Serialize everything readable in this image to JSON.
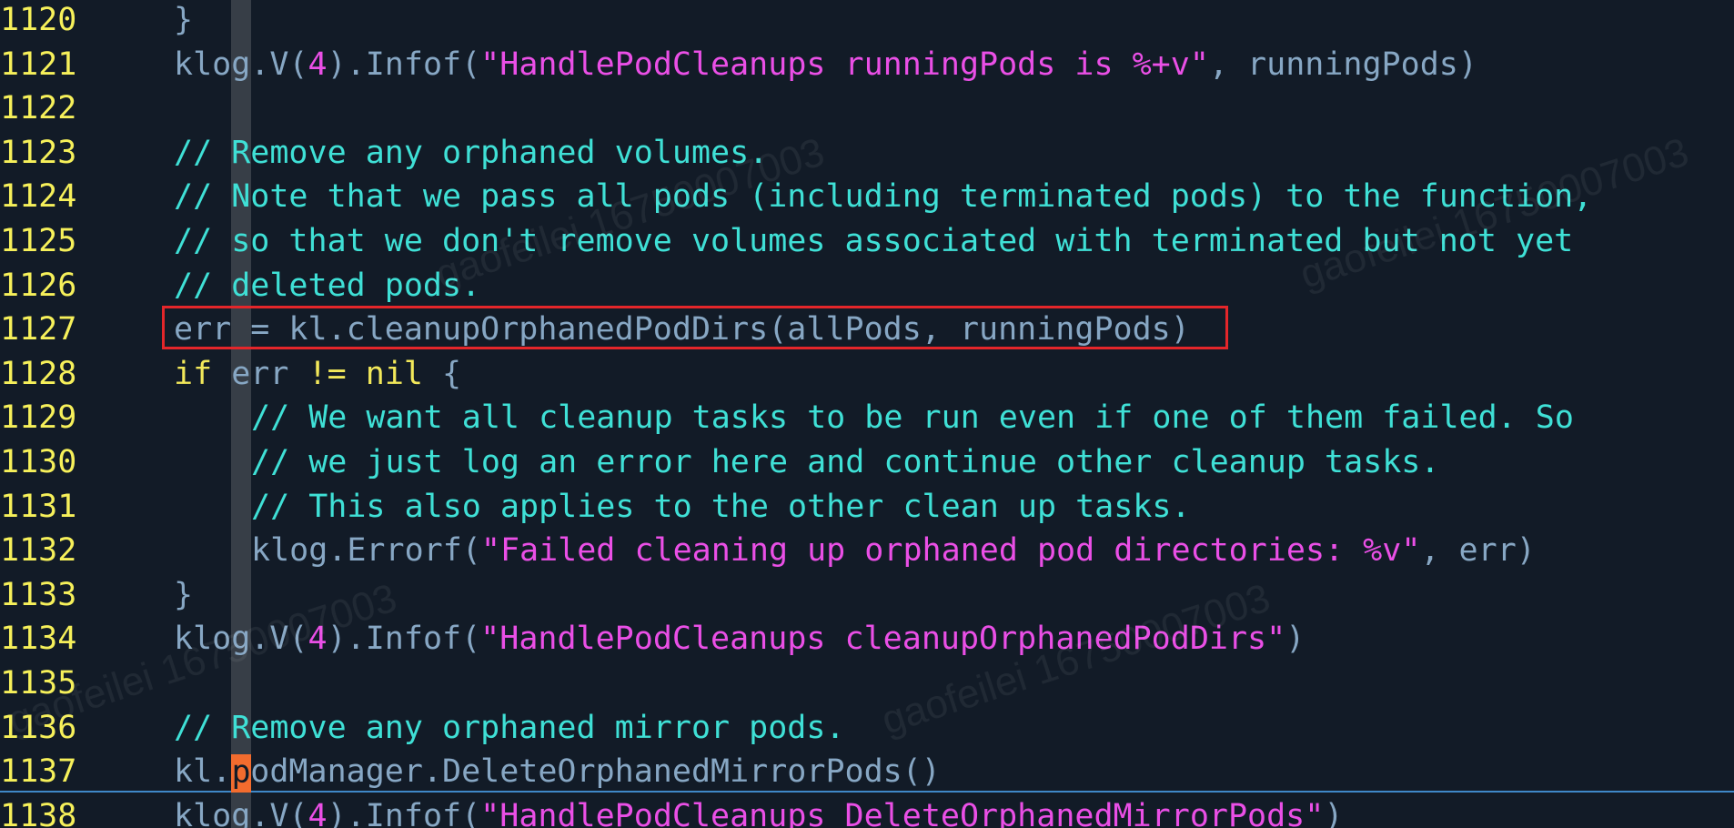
{
  "watermark": "gaofeilei 16750007003",
  "cursor": {
    "char": "p"
  },
  "lines": [
    {
      "num": "1120",
      "parts": [
        [
          "plain",
          "}"
        ]
      ]
    },
    {
      "num": "1121",
      "parts": [
        [
          "plain",
          "klog.V("
        ],
        [
          "num",
          "4"
        ],
        [
          "plain",
          ").Infof("
        ],
        [
          "str",
          "\"HandlePodCleanups runningPods is %+v\""
        ],
        [
          "plain",
          ", runningPods)"
        ]
      ]
    },
    {
      "num": "1122",
      "parts": []
    },
    {
      "num": "1123",
      "parts": [
        [
          "cmt",
          "// Remove any orphaned volumes."
        ]
      ]
    },
    {
      "num": "1124",
      "parts": [
        [
          "cmt",
          "// Note that we pass all pods (including terminated pods) to the function,"
        ]
      ]
    },
    {
      "num": "1125",
      "parts": [
        [
          "cmt",
          "// so that we don't remove volumes associated with terminated but not yet"
        ]
      ]
    },
    {
      "num": "1126",
      "parts": [
        [
          "cmt",
          "// deleted pods."
        ]
      ]
    },
    {
      "num": "1127",
      "parts": [
        [
          "plain",
          "err = kl.cleanupOrphanedPodDirs(allPods, runningPods)"
        ]
      ]
    },
    {
      "num": "1128",
      "parts": [
        [
          "kw",
          "if"
        ],
        [
          "plain",
          " err "
        ],
        [
          "kw",
          "!="
        ],
        [
          "plain",
          " "
        ],
        [
          "kw",
          "nil"
        ],
        [
          "plain",
          " {"
        ]
      ]
    },
    {
      "num": "1129",
      "indent": 2,
      "parts": [
        [
          "cmt",
          "// We want all cleanup tasks to be run even if one of them failed. So"
        ]
      ]
    },
    {
      "num": "1130",
      "indent": 2,
      "parts": [
        [
          "cmt",
          "// we just log an error here and continue other cleanup tasks."
        ]
      ]
    },
    {
      "num": "1131",
      "indent": 2,
      "parts": [
        [
          "cmt",
          "// This also applies to the other clean up tasks."
        ]
      ]
    },
    {
      "num": "1132",
      "indent": 2,
      "parts": [
        [
          "plain",
          "klog.Errorf("
        ],
        [
          "str",
          "\"Failed cleaning up orphaned pod directories: %v\""
        ],
        [
          "plain",
          ", err)"
        ]
      ]
    },
    {
      "num": "1133",
      "parts": [
        [
          "plain",
          "}"
        ]
      ]
    },
    {
      "num": "1134",
      "parts": [
        [
          "plain",
          "klog.V("
        ],
        [
          "num",
          "4"
        ],
        [
          "plain",
          ").Infof("
        ],
        [
          "str",
          "\"HandlePodCleanups cleanupOrphanedPodDirs\""
        ],
        [
          "plain",
          ")"
        ]
      ]
    },
    {
      "num": "1135",
      "parts": []
    },
    {
      "num": "1136",
      "parts": [
        [
          "cmt",
          "// Remove any orphaned mirror pods."
        ]
      ]
    },
    {
      "num": "1137",
      "parts": [
        [
          "plain",
          "kl.podManager.DeleteOrphanedMirrorPods()"
        ]
      ]
    },
    {
      "num": "1138",
      "parts": [
        [
          "plain",
          "klog.V("
        ],
        [
          "num",
          "4"
        ],
        [
          "plain",
          ").Infof("
        ],
        [
          "str",
          "\"HandlePodCleanups DeleteOrphanedMirrorPods\""
        ],
        [
          "plain",
          ")"
        ]
      ]
    }
  ]
}
